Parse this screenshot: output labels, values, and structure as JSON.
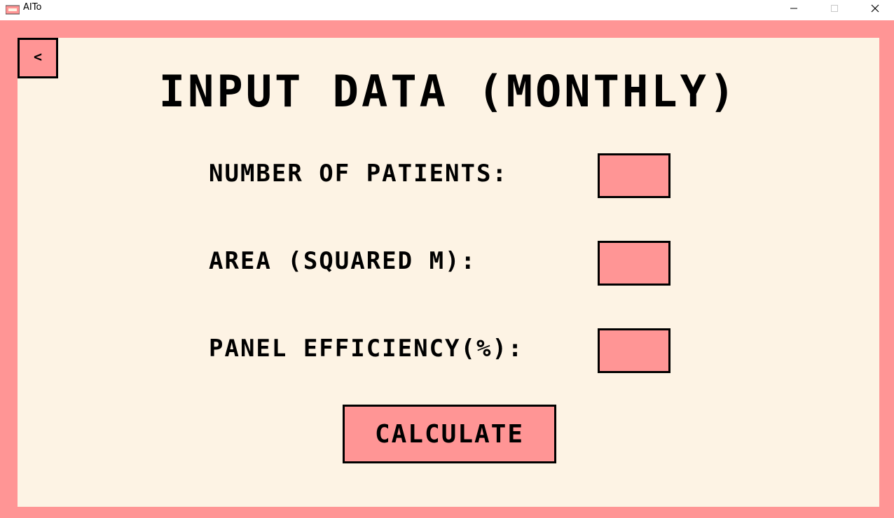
{
  "window": {
    "title": "AITo",
    "icon": "app-icon",
    "controls": [
      "minimize-icon",
      "maximize-icon",
      "close-icon"
    ]
  },
  "colors": {
    "frame": "#ff9595",
    "panel": "#fdf3e4",
    "border": "#000000"
  },
  "back_button": {
    "label": "<"
  },
  "page": {
    "title": "INPUT DATA (MONTHLY)"
  },
  "fields": [
    {
      "label": "NUMBER OF PATIENTS:",
      "value": "",
      "placeholder": ""
    },
    {
      "label": "AREA (SQUARED M):",
      "value": "",
      "placeholder": ""
    },
    {
      "label": "PANEL EFFICIENCY(%):",
      "value": "",
      "placeholder": ""
    }
  ],
  "calculate_button": {
    "label": "CALCULATE"
  }
}
